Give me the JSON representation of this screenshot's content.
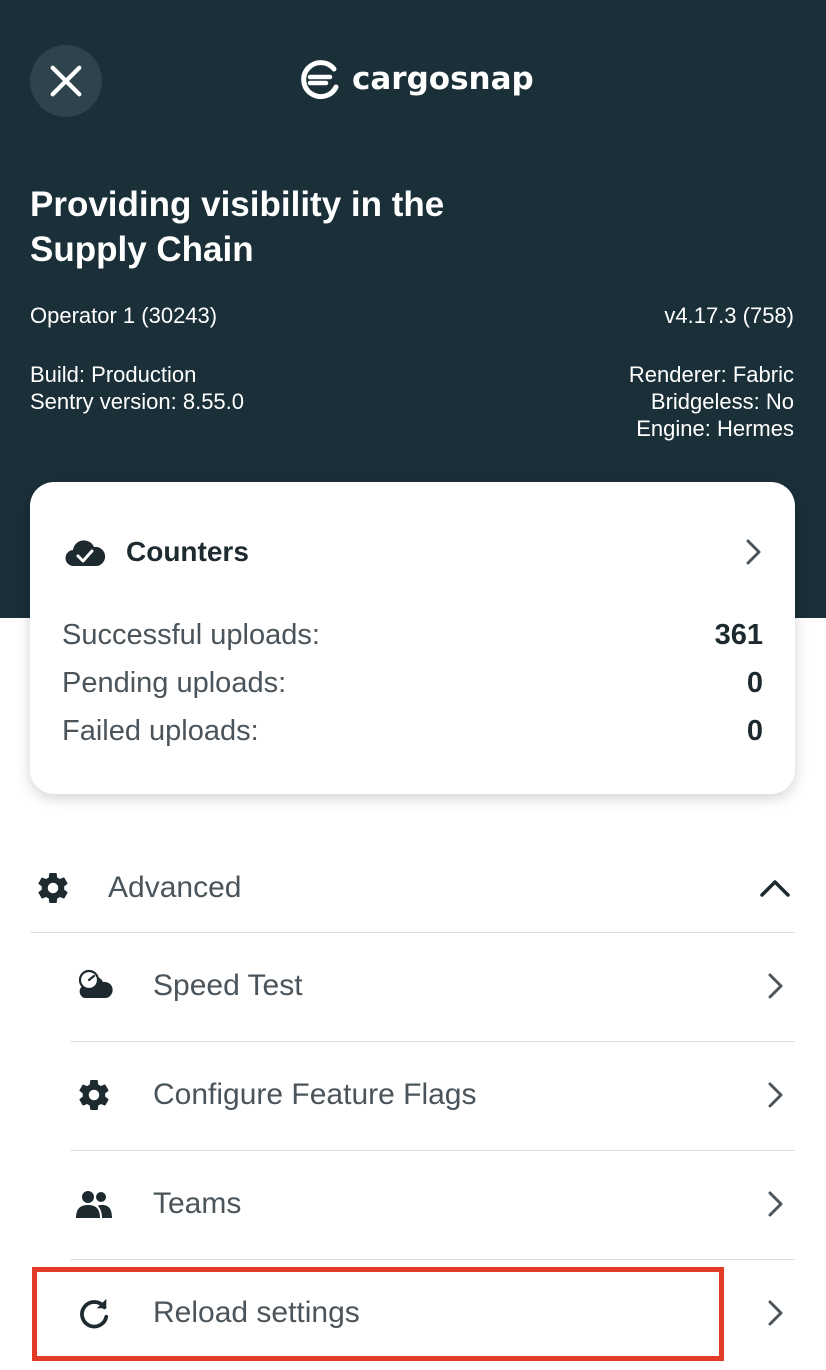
{
  "header": {
    "logo_text": "cargosnap",
    "headline": "Providing visibility in the Supply Chain",
    "operator": "Operator 1 (30243)",
    "version": "v4.17.3 (758)",
    "build": "Build: Production",
    "sentry": "Sentry version: 8.55.0",
    "renderer": "Renderer: Fabric",
    "bridgeless": "Bridgeless: No",
    "engine": "Engine: Hermes"
  },
  "counters": {
    "title": "Counters",
    "rows": [
      {
        "label": "Successful uploads:",
        "value": "361"
      },
      {
        "label": "Pending uploads:",
        "value": "0"
      },
      {
        "label": "Failed uploads:",
        "value": "0"
      }
    ]
  },
  "advanced": {
    "label": "Advanced",
    "items": [
      {
        "label": "Speed Test",
        "icon": "speed-cloud-icon"
      },
      {
        "label": "Configure Feature Flags",
        "icon": "gear-icon"
      },
      {
        "label": "Teams",
        "icon": "people-icon"
      },
      {
        "label": "Reload settings",
        "icon": "reload-icon"
      }
    ]
  },
  "colors": {
    "header_bg": "#1b2f38",
    "highlight": "#e23b26"
  }
}
